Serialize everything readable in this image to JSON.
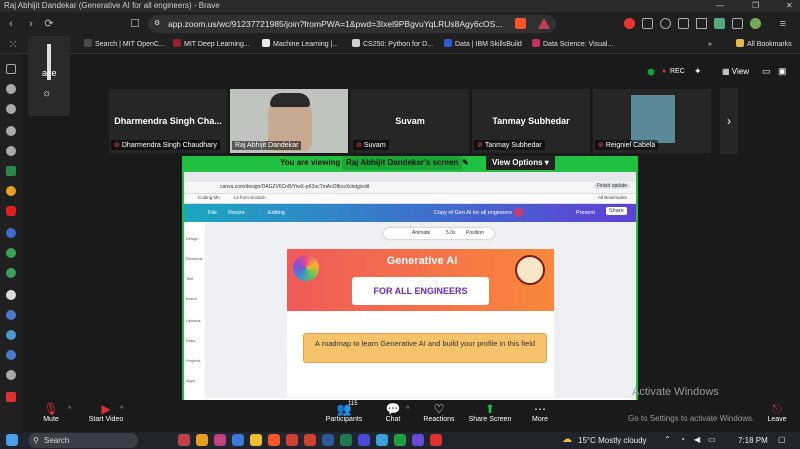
{
  "window": {
    "title": "Raj Abhijit Dandekar (Generative AI for all engineers) - Brave",
    "controls": [
      "—",
      "❐",
      "✕"
    ]
  },
  "browser": {
    "url": "app.zoom.us/wc/91237721985/join?fromPWA=1&pwd=3Ixel9PBgvuYqLRUs8Agy6cOS...",
    "bookmarks": [
      {
        "label": "ds",
        "color": "#888888"
      },
      {
        "label": "Search | MIT OpenC...",
        "color": "#4a4a4a"
      },
      {
        "label": "MIT Deep Learning...",
        "color": "#9a1f2e"
      },
      {
        "label": "Machine Learning |...",
        "color": "#e8e8e8"
      },
      {
        "label": "CS250: Python for D...",
        "color": "#d0d0d0"
      },
      {
        "label": "Data | IBM SkillsBuild",
        "color": "#2d5bd1"
      },
      {
        "label": "Data Science: Visual...",
        "color": "#c03060"
      }
    ],
    "all_bookmarks": "All Bookmarks",
    "more": "»"
  },
  "zoom": {
    "workspace_partial": "ace",
    "rec_label": "REC",
    "view_label": "View",
    "participants": [
      {
        "name": "Dharmendra Singh Cha...",
        "label": "Dharmendra Singh Chaudhary"
      },
      {
        "name": "",
        "label": "Raj Abhijit Dandekar"
      },
      {
        "name": "Suvam",
        "label": "Suvam"
      },
      {
        "name": "Tanmay Subhedar",
        "label": "Tanmay Subhedar"
      },
      {
        "name": "",
        "label": "Reigniel Cabela"
      }
    ],
    "share_bar": {
      "prefix": "You are viewing",
      "presenter": "Raj Abhijit Dandekar's screen",
      "view_options": "View Options"
    },
    "controls": {
      "mute": "Mute",
      "start_video": "Start Video",
      "participants": "Participants",
      "participants_count": "115",
      "chat": "Chat",
      "reactions": "Reactions",
      "share_screen": "Share Screen",
      "more": "More",
      "leave": "Leave"
    },
    "watermark": [
      "Activate Windows",
      "Go to Settings to activate Windows."
    ]
  },
  "shared_screen": {
    "canva_url": "canva.com/design/DAGZV6CnB/YiwX-pK3xcTmAcO8ioxXcbdg/edit",
    "canva_bookmarks": [
      "Coding Mn",
      "Lit from Scratch"
    ],
    "all_bookmarks": "All Bookmarks",
    "finish_update": "Finish update",
    "header": {
      "file": "File",
      "resize": "Resize",
      "editing": "Editing",
      "doc_title": "Copy of Gen AI for all engineers",
      "present": "Present",
      "share": "Share"
    },
    "left_tools": [
      "Design",
      "Elements",
      "Text",
      "Brand",
      "Uploads",
      "Draw",
      "Projects",
      "Apps"
    ],
    "toolbar": {
      "animate": "Animate",
      "duration": "5.0s",
      "position": "Position"
    },
    "slide": {
      "title": "Generative AI",
      "subtitle": "FOR ALL ENGINEERS",
      "box_text": "A roadmap to learn Generative AI and build your profile in this field"
    }
  },
  "taskbar": {
    "search": "Search",
    "weather": "15°C  Mostly cloudy",
    "lang": "ENG\nIN",
    "time": "7:18 PM"
  },
  "colors": {
    "share_green": "#20c040",
    "zoom_dark": "#1a1a1a",
    "muted_red": "#ff4a4a"
  }
}
